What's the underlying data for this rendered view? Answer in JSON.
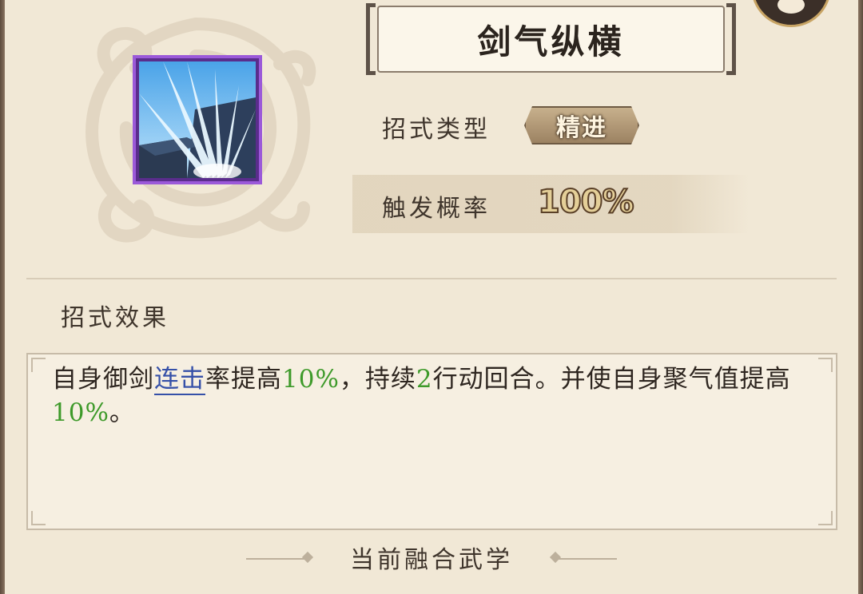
{
  "skill": {
    "name": "剑气纵横",
    "type_label": "招式类型",
    "type_value": "精进",
    "rate_label": "触发概率",
    "rate_value": "100%"
  },
  "effect": {
    "section_label": "招式效果",
    "t1": "自身御剑",
    "link": "连击",
    "t2": "率提高",
    "v1": "10%",
    "t3": "，持续",
    "v2": "2",
    "t4": "行动回合。并使自身聚气值提高",
    "v3": "10%",
    "t5": "。"
  },
  "footer": {
    "title": "当前融合武学"
  },
  "colors": {
    "background": "#f1e8d6",
    "highlight_green": "#3e9a2a",
    "link_blue": "#3550a8",
    "icon_border": "#9b59d9"
  },
  "icons": {
    "skill_icon": "sword-burst-icon",
    "corner_button": "chat-bubble-icon",
    "background_ornament": "cloud-ornament"
  }
}
